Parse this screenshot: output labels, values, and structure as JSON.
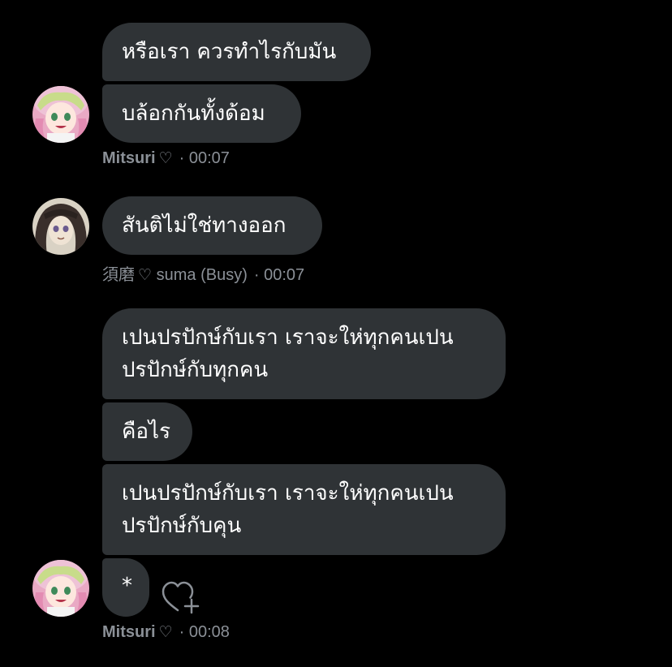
{
  "messages": [
    {
      "lines": [
        "หรือเรา ควรทำไรกับมัน"
      ]
    },
    {
      "lines": [
        "บล้อกกันทั้งด้อม"
      ]
    },
    {
      "lines": [
        "สันติไม่ใช่ทางออก"
      ]
    },
    {
      "lines": [
        "เปนปรปักษ์กับเรา เราจะให่ทุกคนเปน",
        "ปรปักษ์กับทุกคน"
      ]
    },
    {
      "lines": [
        "คือไร"
      ]
    },
    {
      "lines": [
        "เปนปรปักษ์กับเรา เราจะให่ทุกคนเปน",
        "ปรปักษ์กับคุน"
      ]
    },
    {
      "lines": [
        "*"
      ]
    }
  ],
  "meta": [
    {
      "name": "Mitsuri",
      "heart": "♡",
      "time": "· 00:07"
    },
    {
      "name": "須磨",
      "heart": "♡",
      "status": "suma (Busy)",
      "time": "· 00:07"
    },
    {
      "name": "Mitsuri",
      "heart": "♡",
      "time": "· 00:08"
    }
  ],
  "icons": {
    "avatar_1": "pink-hair-avatar-icon",
    "avatar_2": "dark-hair-avatar-icon",
    "avatar_3": "pink-hair-avatar-icon",
    "like": "heart-plus-icon"
  },
  "colors": {
    "background": "#000000",
    "bubble": "#2f3336",
    "text": "#ffffff",
    "meta_text": "#8b9097"
  }
}
